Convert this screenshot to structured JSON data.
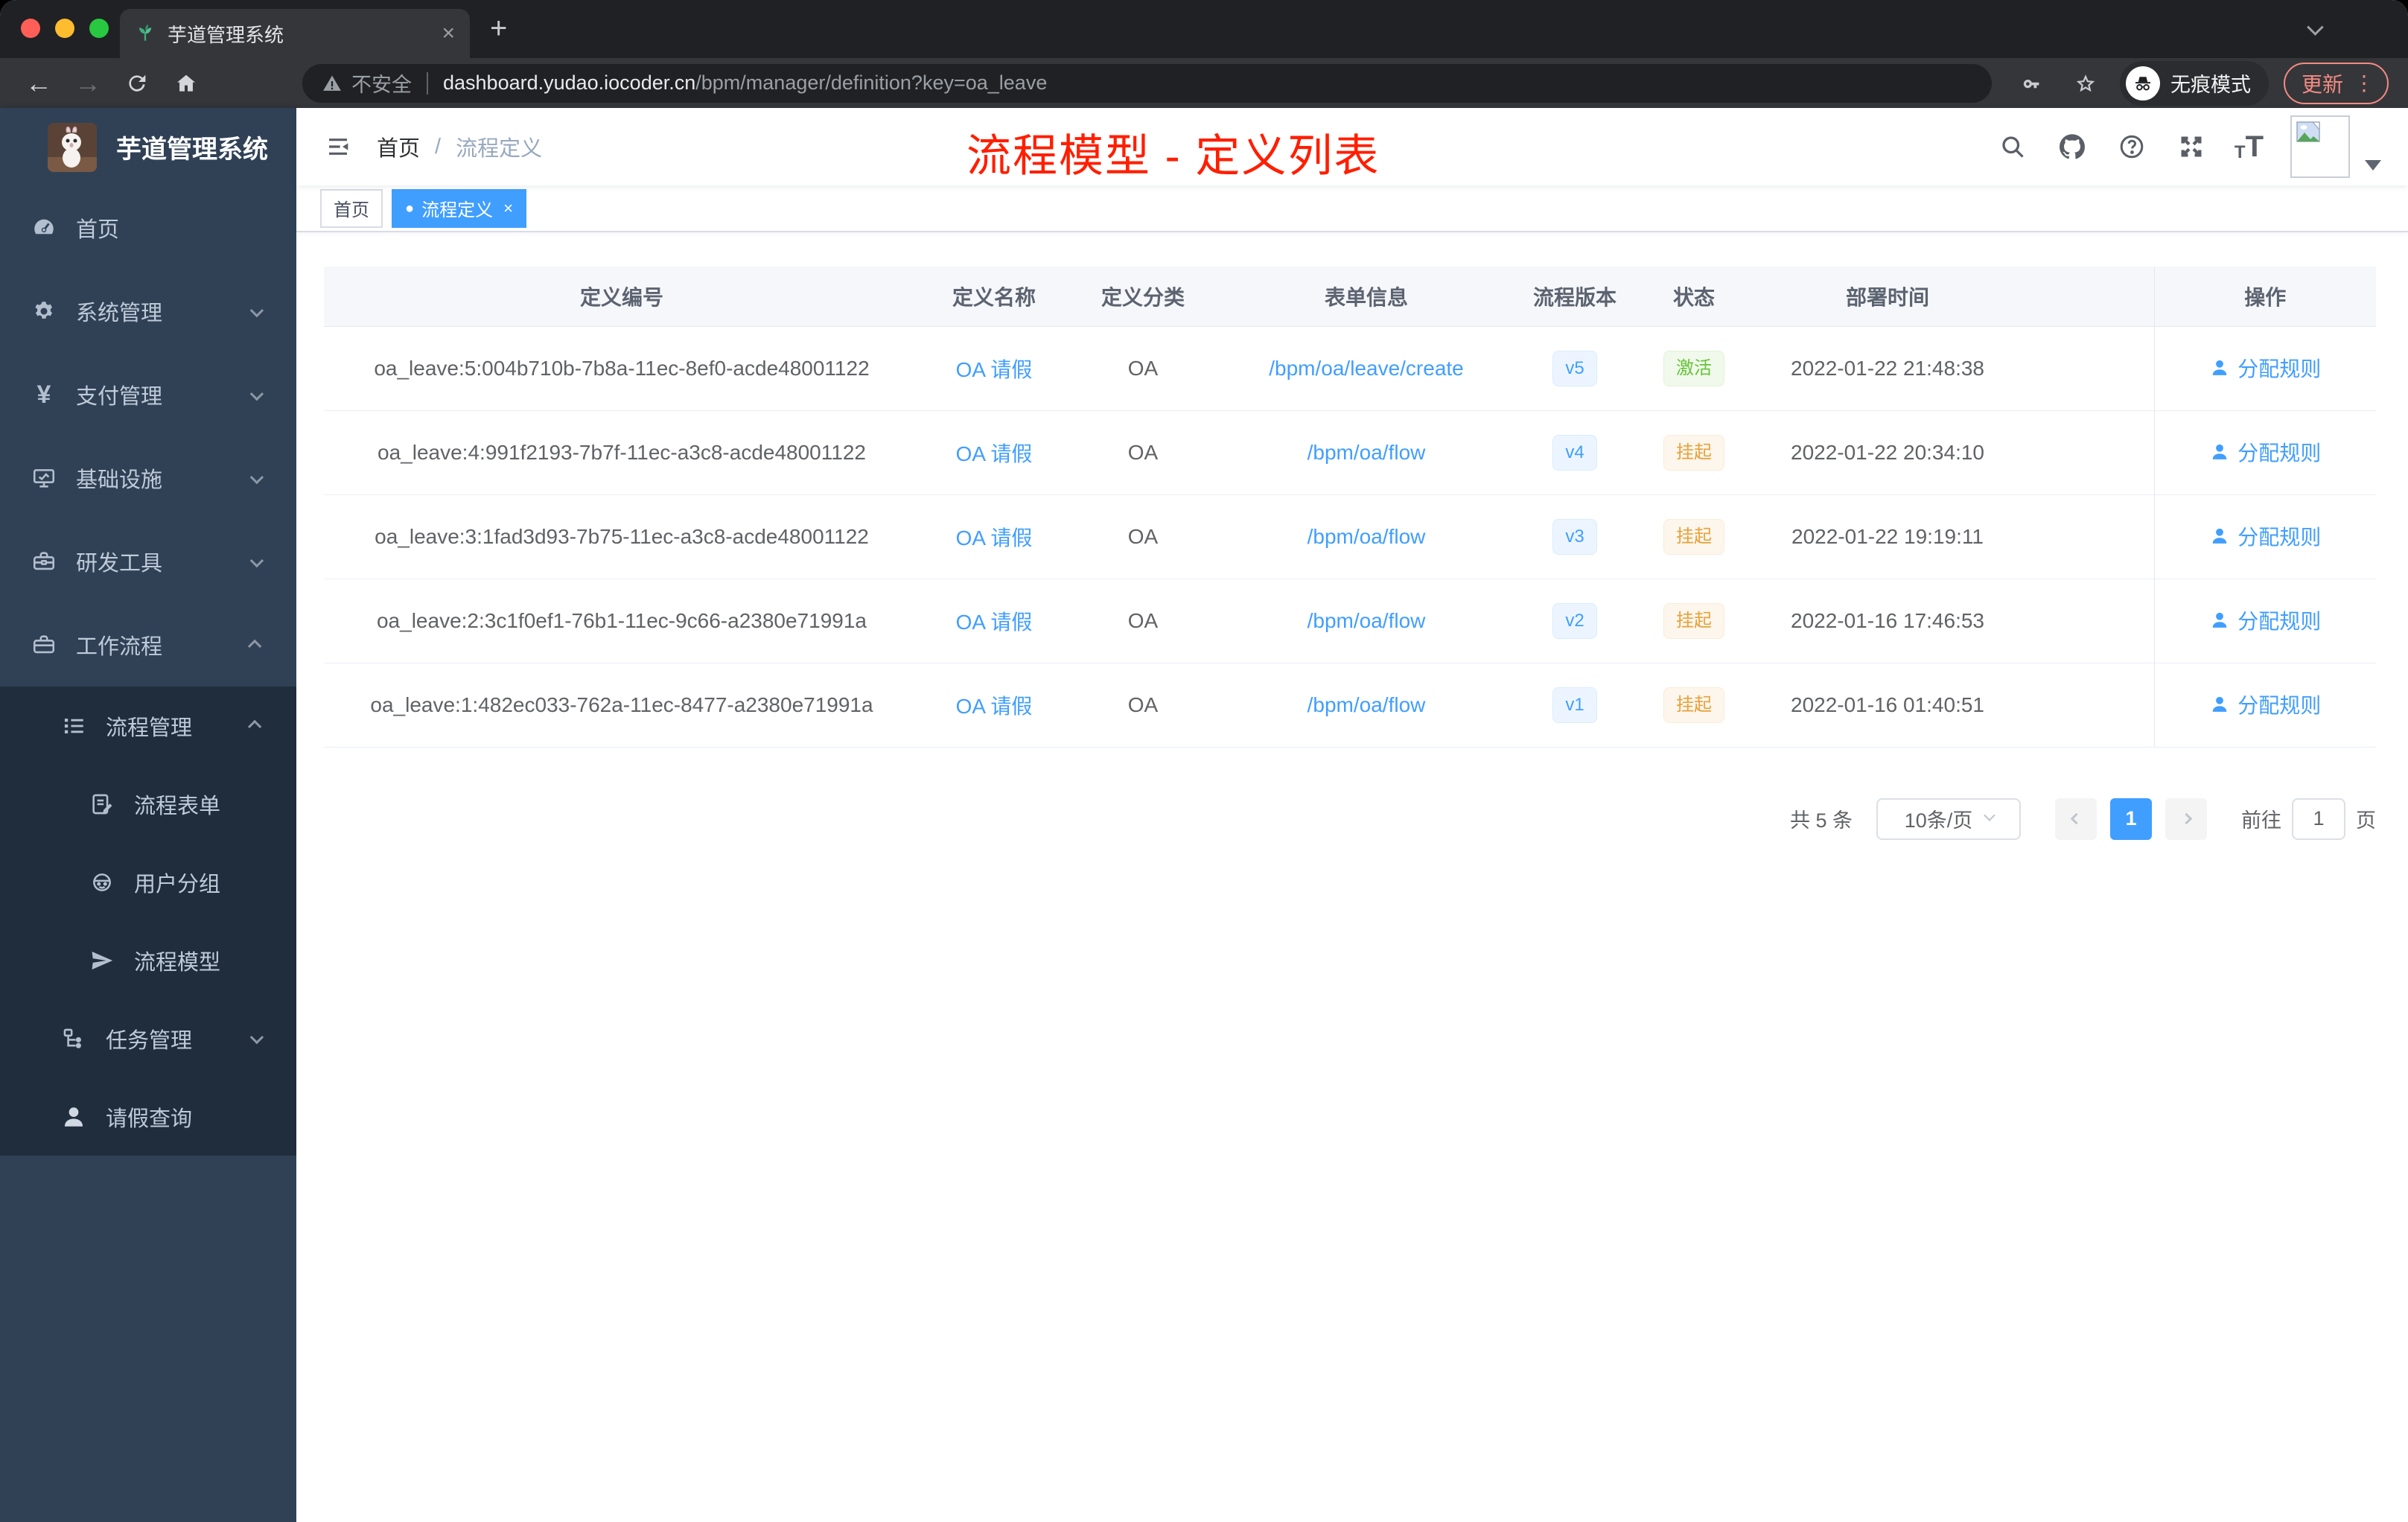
{
  "browser": {
    "tab_title": "芋道管理系统",
    "security_label": "不安全",
    "url_host": "dashboard.yudao.iocoder.cn",
    "url_path": "/bpm/manager/definition?key=oa_leave",
    "incognito_label": "无痕模式",
    "update_label": "更新"
  },
  "icons": {
    "close_tab": "×",
    "new_tab": "+",
    "back": "←",
    "forward": "→",
    "more_menu": "⋮",
    "help": "?",
    "yen": "¥",
    "active_dot": "●",
    "tag_close": "×",
    "font_small": "T",
    "font_large": "T"
  },
  "sidebar": {
    "title": "芋道管理系统",
    "items": [
      {
        "label": "首页"
      },
      {
        "label": "系统管理"
      },
      {
        "label": "支付管理"
      },
      {
        "label": "基础设施"
      },
      {
        "label": "研发工具"
      },
      {
        "label": "工作流程"
      },
      {
        "label": "流程管理"
      },
      {
        "label": "流程表单"
      },
      {
        "label": "用户分组"
      },
      {
        "label": "流程模型"
      },
      {
        "label": "任务管理"
      },
      {
        "label": "请假查询"
      }
    ]
  },
  "header": {
    "breadcrumb_home": "首页",
    "breadcrumb_separator": "/",
    "breadcrumb_current": "流程定义",
    "annotation": "流程模型 - 定义列表"
  },
  "tags": {
    "home": "首页",
    "current": "流程定义"
  },
  "table": {
    "columns": [
      "定义编号",
      "定义名称",
      "定义分类",
      "表单信息",
      "流程版本",
      "状态",
      "部署时间",
      "操作"
    ],
    "rows": [
      {
        "id": "oa_leave:5:004b710b-7b8a-11ec-8ef0-acde48001122",
        "name": "OA 请假",
        "category": "OA",
        "form": "/bpm/oa/leave/create",
        "version": "v5",
        "status": "激活",
        "time": "2022-01-22 21:48:38",
        "action": "分配规则"
      },
      {
        "id": "oa_leave:4:991f2193-7b7f-11ec-a3c8-acde48001122",
        "name": "OA 请假",
        "category": "OA",
        "form": "/bpm/oa/flow",
        "version": "v4",
        "status": "挂起",
        "time": "2022-01-22 20:34:10",
        "action": "分配规则"
      },
      {
        "id": "oa_leave:3:1fad3d93-7b75-11ec-a3c8-acde48001122",
        "name": "OA 请假",
        "category": "OA",
        "form": "/bpm/oa/flow",
        "version": "v3",
        "status": "挂起",
        "time": "2022-01-22 19:19:11",
        "action": "分配规则"
      },
      {
        "id": "oa_leave:2:3c1f0ef1-76b1-11ec-9c66-a2380e71991a",
        "name": "OA 请假",
        "category": "OA",
        "form": "/bpm/oa/flow",
        "version": "v2",
        "status": "挂起",
        "time": "2022-01-16 17:46:53",
        "action": "分配规则"
      },
      {
        "id": "oa_leave:1:482ec033-762a-11ec-8477-a2380e71991a",
        "name": "OA 请假",
        "category": "OA",
        "form": "/bpm/oa/flow",
        "version": "v1",
        "status": "挂起",
        "time": "2022-01-16 01:40:51",
        "action": "分配规则"
      }
    ]
  },
  "pagination": {
    "total": "共 5 条",
    "page_size": "10条/页",
    "current_page": "1",
    "goto_label": "前往",
    "goto_value": "1",
    "page_unit": "页"
  },
  "colors": {
    "accent": "#409eff",
    "status_active": "#67c23a",
    "status_suspended": "#e6a23c",
    "sidebar_bg": "#304156",
    "annotation_red": "#ff1e00"
  }
}
